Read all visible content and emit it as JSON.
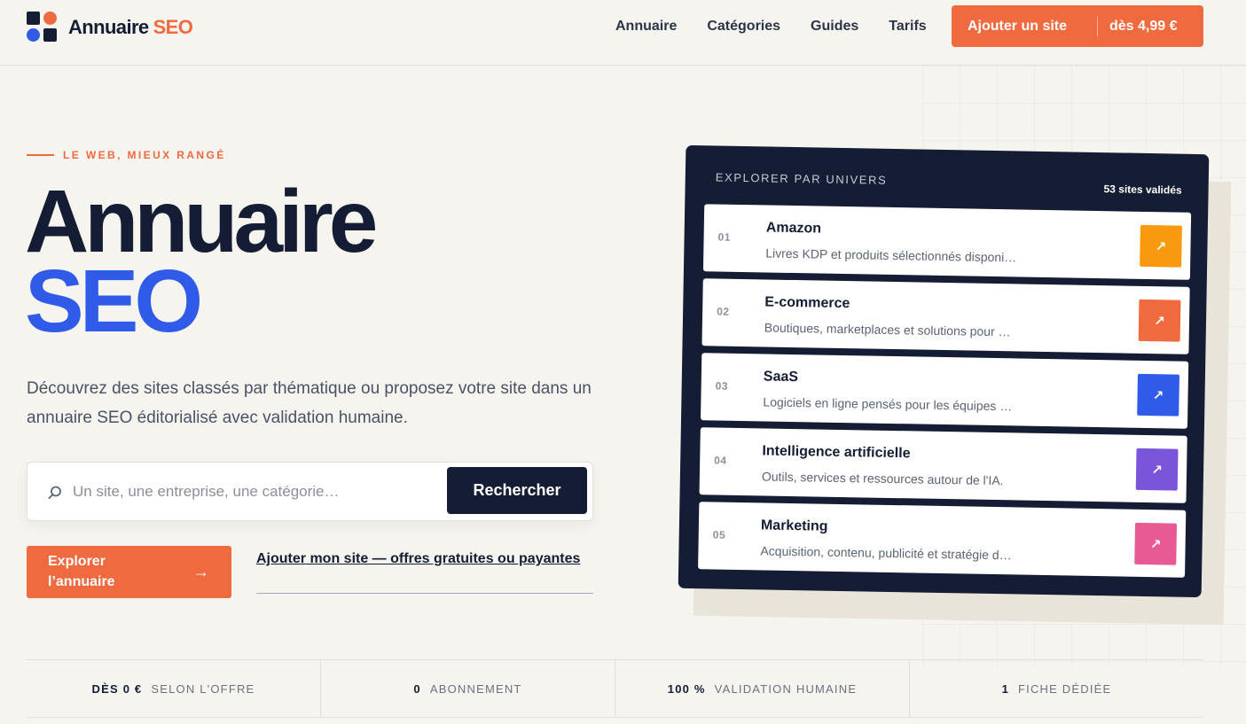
{
  "header": {
    "logo_text": "Annuaire",
    "logo_accent": "SEO",
    "nav": [
      {
        "label": "Annuaire"
      },
      {
        "label": "Catégories"
      },
      {
        "label": "Guides"
      },
      {
        "label": "Tarifs"
      }
    ],
    "cta_label": "Ajouter un site",
    "cta_price": "dès 4,99 €"
  },
  "hero": {
    "eyebrow": "LE WEB, MIEUX RANGÉ",
    "title_line1": "Annuaire",
    "title_line2": "SEO",
    "description": "Découvrez des sites classés par thématique ou proposez votre site dans un annuaire SEO éditorialisé avec validation humaine.",
    "search": {
      "placeholder": "Un site, une entreprise, une catégorie…",
      "value": "",
      "button_label": "Rechercher"
    },
    "explore_label": "Explorer l’annuaire",
    "explore_arrow": "→",
    "add_site_link": "Ajouter mon site — offres gratuites ou payantes"
  },
  "panel": {
    "heading": "EXPLORER PAR UNIVERS",
    "count": "53 sites validés",
    "categories": [
      {
        "num": "01",
        "name": "Amazon",
        "desc": "Livres KDP et produits sélectionnés disponi…",
        "color": "#f99a0e"
      },
      {
        "num": "02",
        "name": "E-commerce",
        "desc": "Boutiques, marketplaces et solutions pour …",
        "color": "#f06a3f"
      },
      {
        "num": "03",
        "name": "SaaS",
        "desc": "Logiciels en ligne pensés pour les équipes …",
        "color": "#2f5be8"
      },
      {
        "num": "04",
        "name": "Intelligence artificielle",
        "desc": "Outils, services et ressources autour de l'IA.",
        "color": "#7a55d9"
      },
      {
        "num": "05",
        "name": "Marketing",
        "desc": "Acquisition, contenu, publicité et stratégie d…",
        "color": "#e85a93"
      }
    ]
  },
  "stats": [
    {
      "value": "DÈS 0 €",
      "label": "SELON L'OFFRE"
    },
    {
      "value": "0",
      "label": "ABONNEMENT"
    },
    {
      "value": "100 %",
      "label": "VALIDATION HUMAINE"
    },
    {
      "value": "1",
      "label": "FICHE DÉDIÉE"
    }
  ]
}
